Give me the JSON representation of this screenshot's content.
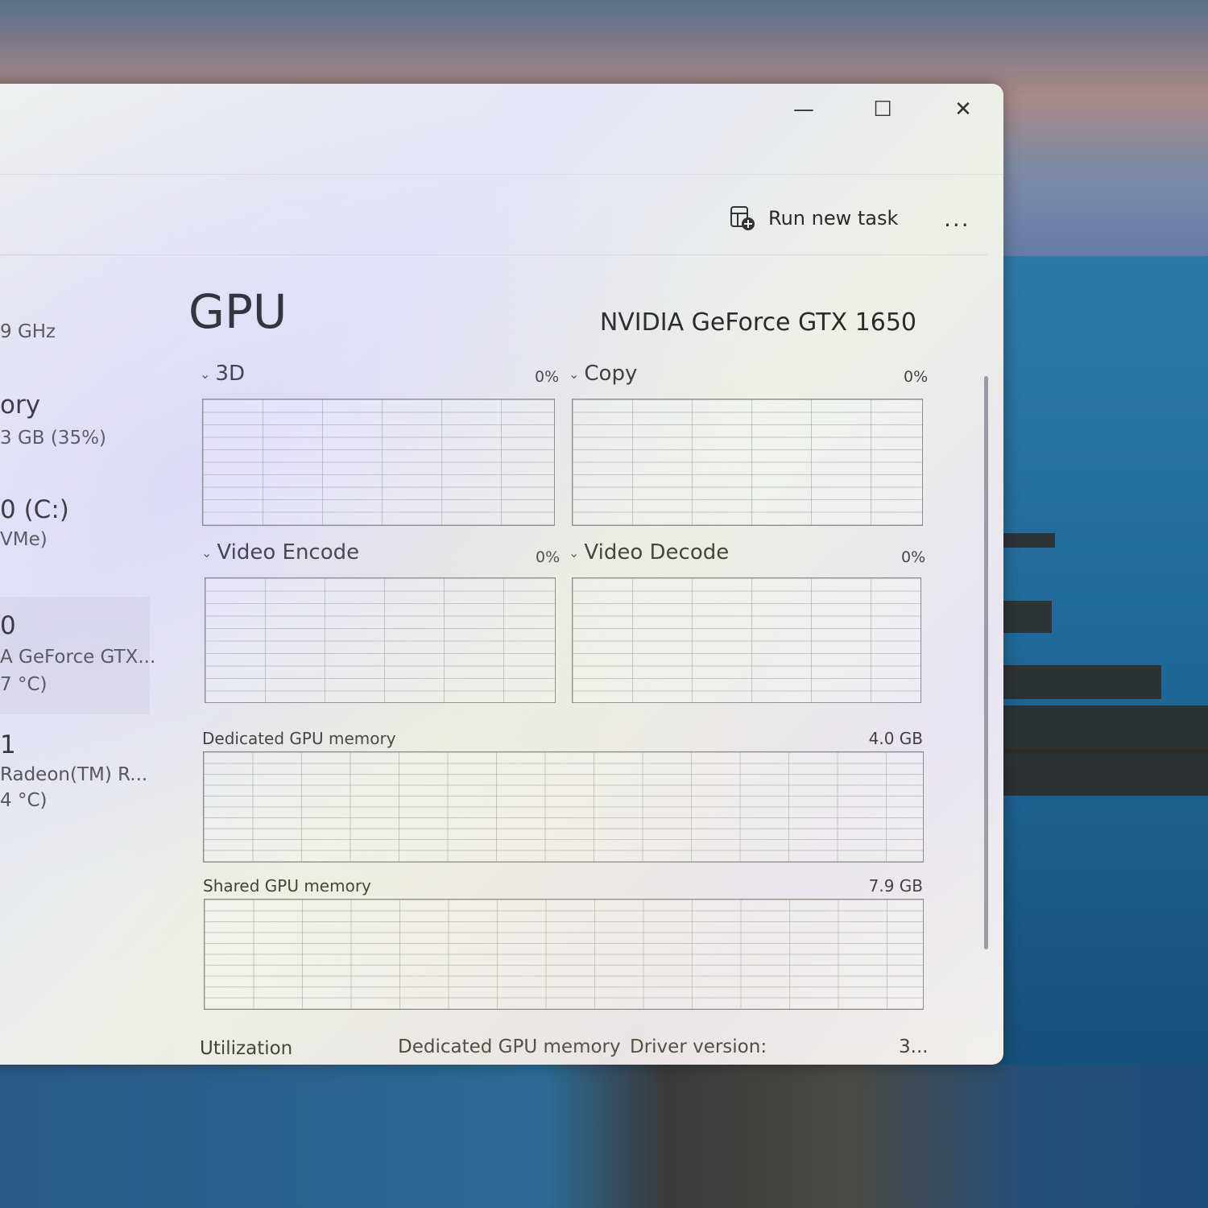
{
  "window": {
    "minimize_glyph": "—",
    "maximize_glyph": "☐",
    "close_glyph": "✕"
  },
  "toolbar": {
    "run_new_task_label": "Run new task",
    "more_label": "..."
  },
  "sidebar": {
    "items": [
      {
        "line1": "9 GHz"
      },
      {
        "line1": "ory",
        "line2": "3 GB (35%)"
      },
      {
        "line1": "0 (C:)",
        "line2": "VMe)"
      },
      {
        "line1": "0",
        "line2": "A GeForce GTX...",
        "line3": "7 °C)"
      },
      {
        "line1": "1",
        "line2": "Radeon(TM) R...",
        "line3": "4 °C)"
      }
    ]
  },
  "gpu": {
    "title": "GPU",
    "model": "NVIDIA GeForce GTX 1650",
    "engines": [
      {
        "name": "3D",
        "percent": "0%"
      },
      {
        "name": "Copy",
        "percent": "0%"
      },
      {
        "name": "Video Encode",
        "percent": "0%"
      },
      {
        "name": "Video Decode",
        "percent": "0%"
      }
    ],
    "dedicated_memory": {
      "label": "Dedicated GPU memory",
      "value": "4.0 GB"
    },
    "shared_memory": {
      "label": "Shared GPU memory",
      "value": "7.9 GB"
    }
  },
  "footer": {
    "utilization": "Utilization",
    "dedicated_memory": "Dedicated GPU memory",
    "driver_version_label": "Driver version:",
    "driver_version_value": "3..."
  }
}
